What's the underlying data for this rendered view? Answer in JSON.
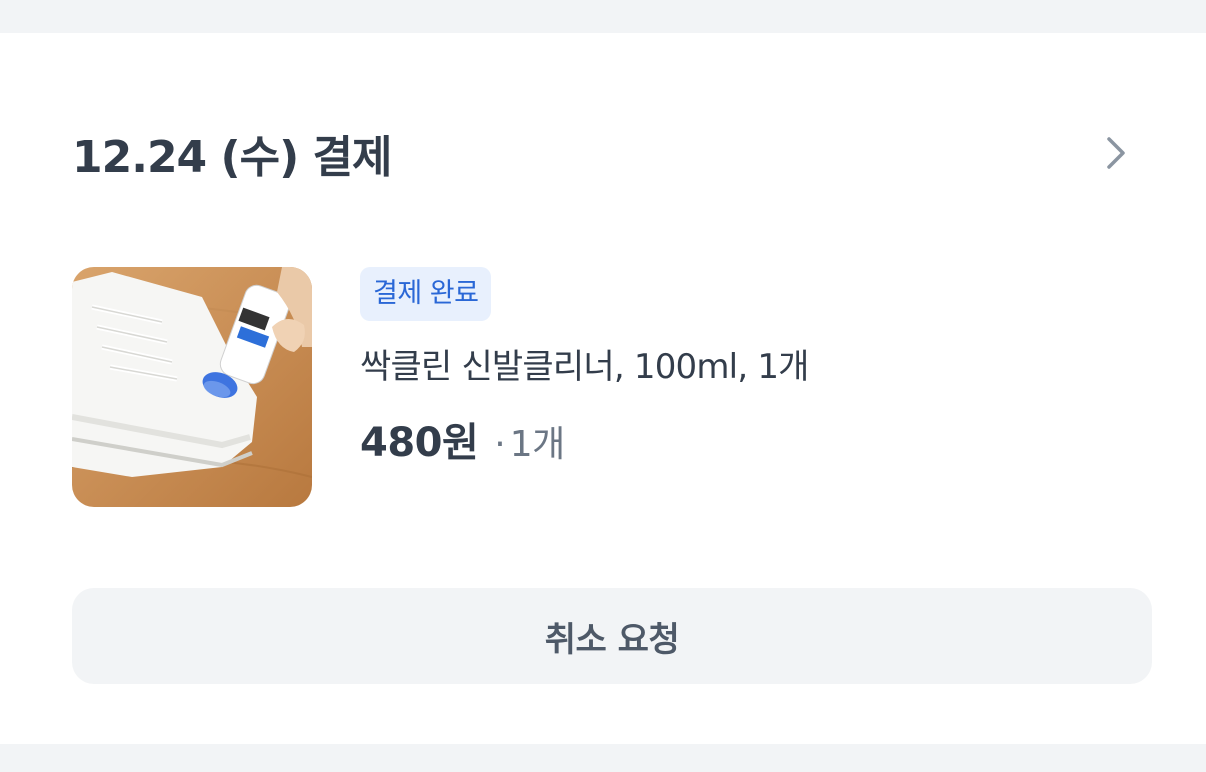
{
  "order": {
    "date_label": "12.24 (수) 결제",
    "detail_icon": "chevron-right-icon",
    "item": {
      "thumbnail": "product-thumbnail",
      "status_badge": "결제 완료",
      "name": "싹클린 신발클리너, 100ml, 1개",
      "price": "480원",
      "quantity_separator": "·",
      "quantity": "1개"
    },
    "cancel_label": "취소 요청"
  },
  "colors": {
    "page_background": "#f2f4f6",
    "card_background": "#ffffff",
    "badge_background": "#e8f0fd",
    "badge_text": "#2a67d6",
    "primary_text": "#333d4b",
    "secondary_text": "#6b7684",
    "button_background": "#f2f4f6",
    "chevron": "#8b95a1"
  }
}
